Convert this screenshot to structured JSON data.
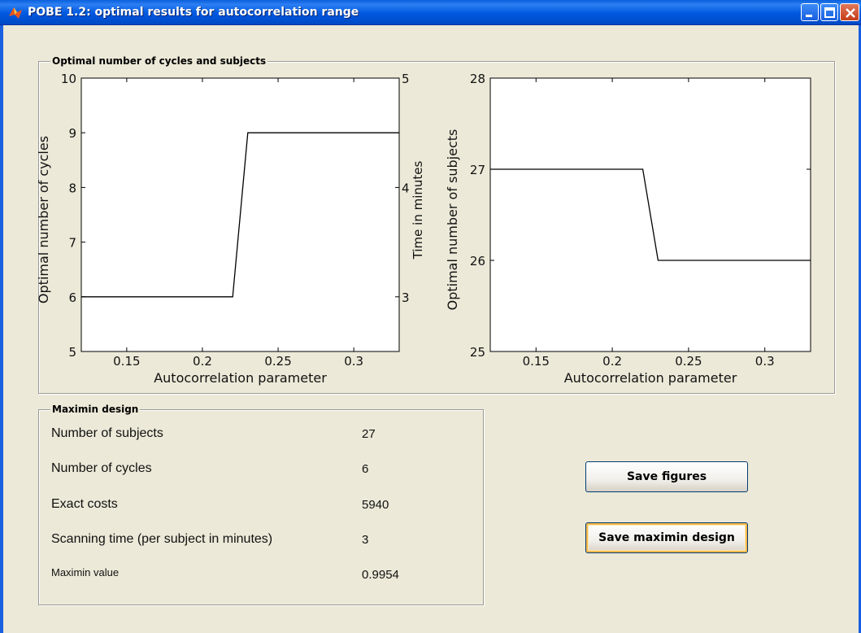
{
  "window": {
    "title": "POBE 1.2: optimal results for autocorrelation range"
  },
  "plots_group": {
    "title": "Optimal number of cycles and subjects"
  },
  "chart_data": [
    {
      "type": "line",
      "title": "",
      "xlabel": "Autocorrelation parameter",
      "ylabel": "Optimal number of cycles",
      "y2label": "Time in minutes",
      "xlim": [
        0.12,
        0.33
      ],
      "ylim": [
        5,
        10
      ],
      "y2lim": [
        2.5,
        5
      ],
      "xticks": [
        "0.15",
        "0.2",
        "0.25",
        "0.3"
      ],
      "xtick_values": [
        0.15,
        0.2,
        0.25,
        0.3
      ],
      "yticks": [
        "5",
        "6",
        "7",
        "8",
        "9",
        "10"
      ],
      "ytick_values": [
        5,
        6,
        7,
        8,
        9,
        10
      ],
      "y2ticks": [
        "3",
        "4",
        "5"
      ],
      "y2tick_values": [
        3,
        4,
        5
      ],
      "series": [
        {
          "x": [
            0.12,
            0.22,
            0.23,
            0.33
          ],
          "y": [
            6,
            6,
            9,
            9
          ]
        }
      ]
    },
    {
      "type": "line",
      "title": "",
      "xlabel": "Autocorrelation parameter",
      "ylabel": "Optimal number of subjects",
      "xlim": [
        0.12,
        0.33
      ],
      "ylim": [
        25,
        28
      ],
      "xticks": [
        "0.15",
        "0.2",
        "0.25",
        "0.3"
      ],
      "xtick_values": [
        0.15,
        0.2,
        0.25,
        0.3
      ],
      "yticks": [
        "25",
        "26",
        "27",
        "28"
      ],
      "ytick_values": [
        25,
        26,
        27,
        28
      ],
      "series": [
        {
          "x": [
            0.12,
            0.22,
            0.23,
            0.33
          ],
          "y": [
            27,
            27,
            26,
            26
          ]
        }
      ]
    }
  ],
  "design": {
    "title": "Maximin design",
    "rows": [
      {
        "label": "Number of subjects",
        "value": "27"
      },
      {
        "label": "Number of cycles",
        "value": "6"
      },
      {
        "label": "Exact costs",
        "value": "5940"
      },
      {
        "label": "Scanning time (per subject in minutes)",
        "value": "3"
      },
      {
        "label": "Maximin value",
        "value": "0.9954"
      }
    ]
  },
  "buttons": {
    "save_figures": "Save figures",
    "save_maximin": "Save maximin design"
  },
  "colors": {
    "title_bar": "#0058e0",
    "background": "#ece9d8",
    "default_button_highlight": "#f6b84a"
  }
}
